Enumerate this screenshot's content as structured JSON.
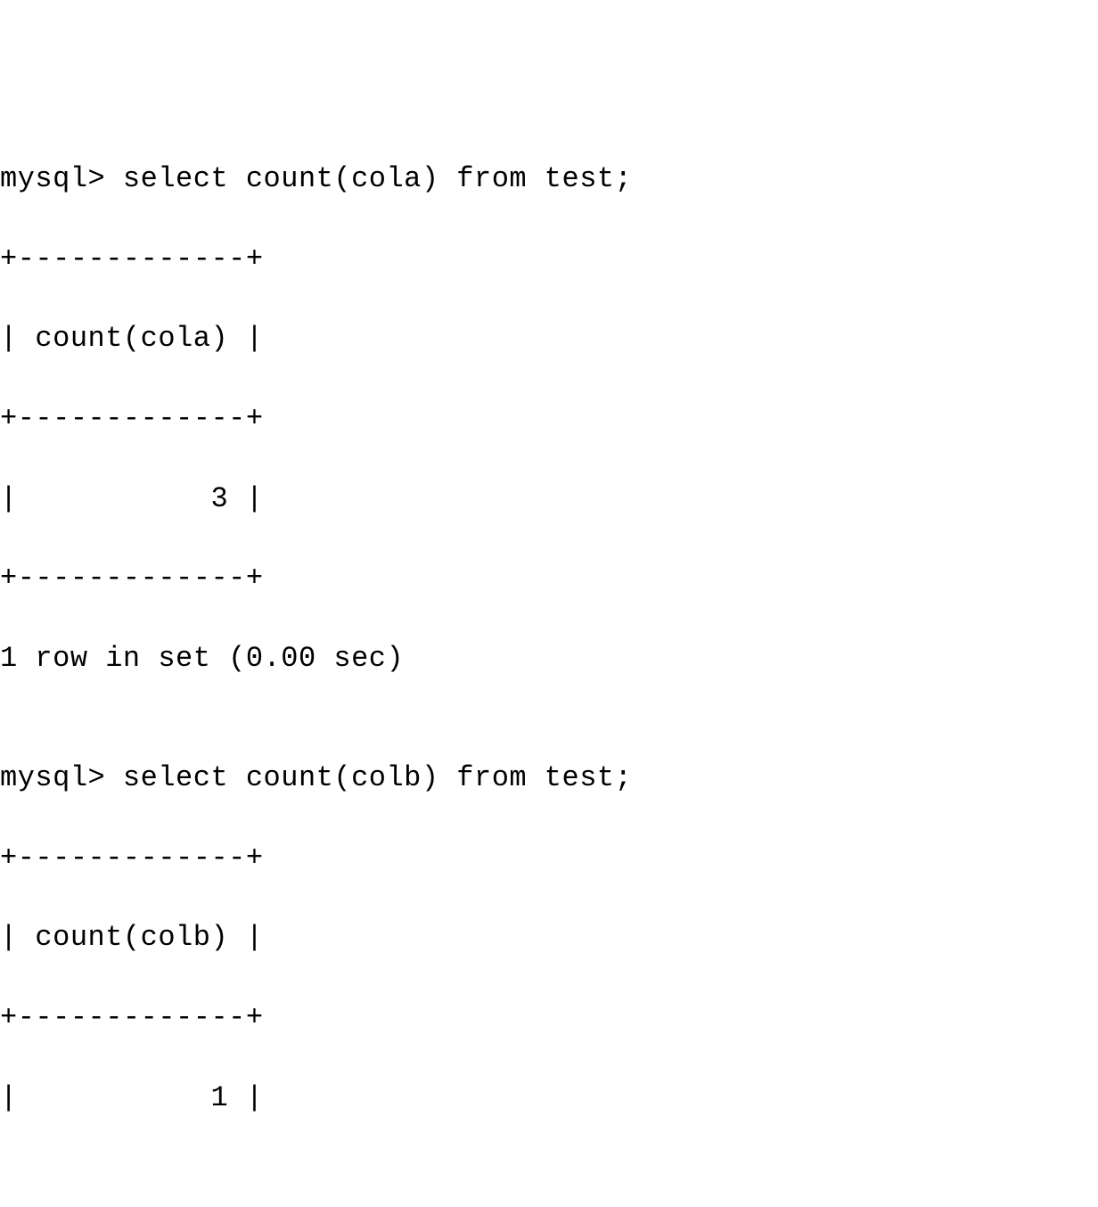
{
  "terminal": {
    "lines": [
      "mysql> select count(cola) from test;",
      "+-------------+",
      "| count(cola) |",
      "+-------------+",
      "|           3 |",
      "+-------------+",
      "1 row in set (0.00 sec)",
      "",
      "mysql> select count(colb) from test;",
      "+-------------+",
      "| count(colb) |",
      "+-------------+",
      "|           1 |"
    ]
  }
}
